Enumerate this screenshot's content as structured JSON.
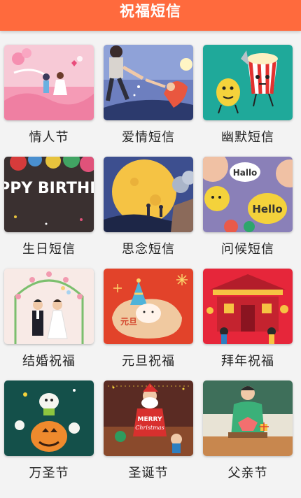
{
  "header": {
    "title": "祝福短信"
  },
  "categories": [
    {
      "label": "情人节",
      "icon": "valentine-illustration"
    },
    {
      "label": "爱情短信",
      "icon": "love-illustration"
    },
    {
      "label": "幽默短信",
      "icon": "humor-illustration"
    },
    {
      "label": "生日短信",
      "icon": "birthday-illustration",
      "art_text": "HAPPY BIRTHDAY"
    },
    {
      "label": "思念短信",
      "icon": "moon-illustration"
    },
    {
      "label": "问候短信",
      "icon": "greeting-illustration",
      "art_text_1": "Hallo",
      "art_text_2": "Hello"
    },
    {
      "label": "结婚祝福",
      "icon": "wedding-illustration"
    },
    {
      "label": "元旦祝福",
      "icon": "new-year-illustration",
      "art_text": "元旦"
    },
    {
      "label": "拜年祝福",
      "icon": "spring-festival-illustration"
    },
    {
      "label": "万圣节",
      "icon": "halloween-illustration"
    },
    {
      "label": "圣诞节",
      "icon": "christmas-illustration",
      "art_text_1": "MERRY",
      "art_text_2": "Christmas"
    },
    {
      "label": "父亲节",
      "icon": "fathers-day-illustration"
    }
  ],
  "colors": {
    "header": "#ff6a3d",
    "background": "#f3f3f3",
    "label": "#222222"
  }
}
